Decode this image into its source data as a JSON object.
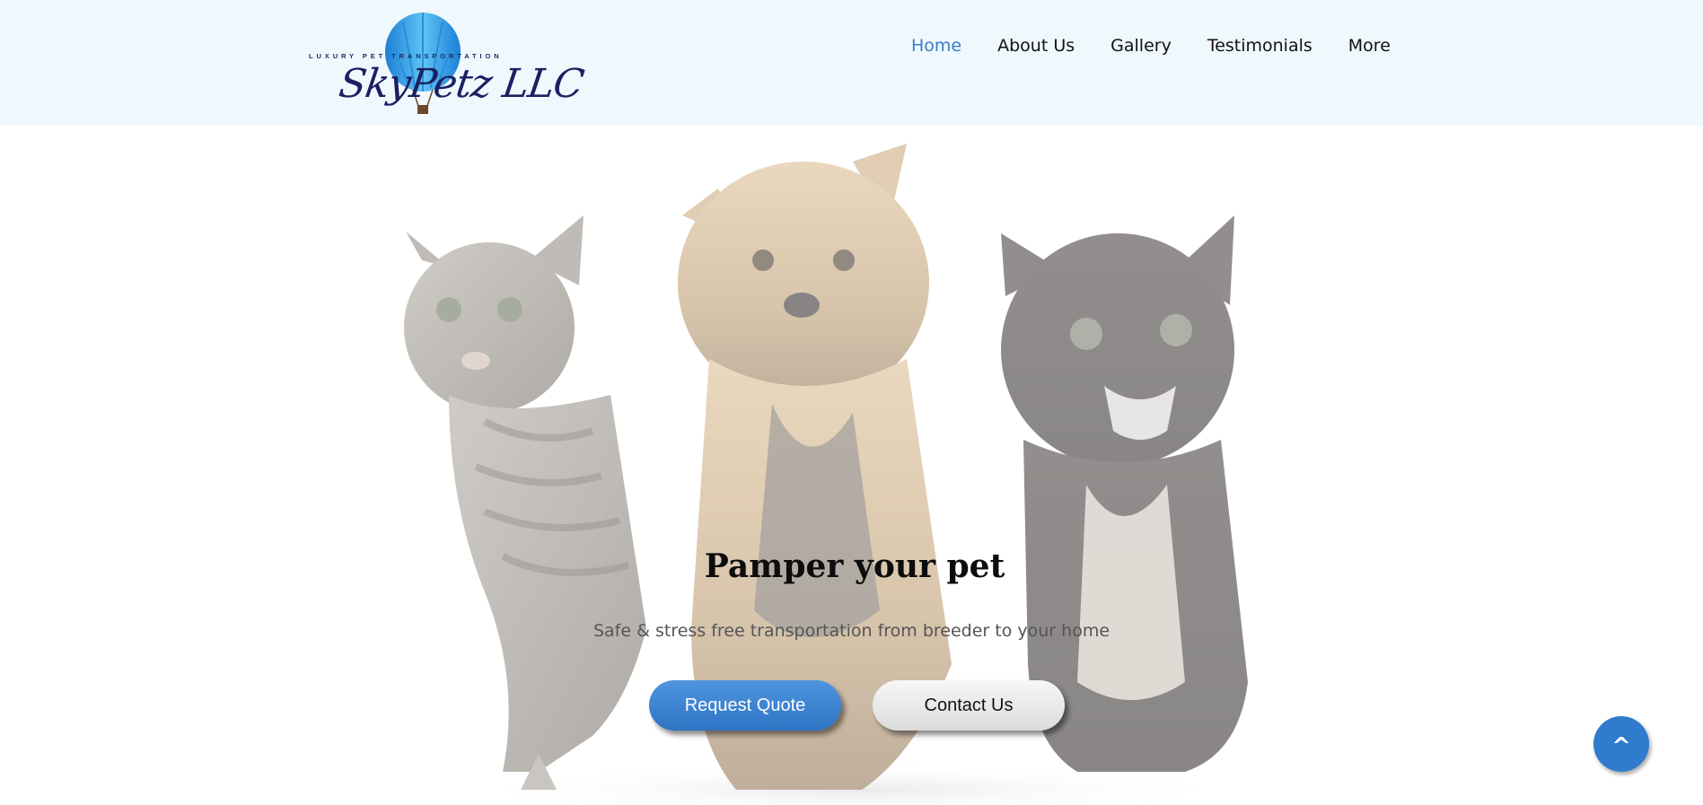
{
  "brand": {
    "tagline": "LUXURY PET TRANSPORTATION",
    "name": "SkyPetz LLC",
    "logo_icon": "hot-air-balloon",
    "balloon_color": "#3aa6e8"
  },
  "nav": {
    "items": [
      {
        "label": "Home",
        "active": true
      },
      {
        "label": "About Us",
        "active": false
      },
      {
        "label": "Gallery",
        "active": false
      },
      {
        "label": "Testimonials",
        "active": false
      },
      {
        "label": "More",
        "active": false
      }
    ]
  },
  "hero": {
    "title": "Pamper your pet",
    "subtitle": "Safe & stress free transportation from breeder to your home",
    "image": "tabby-cat-yorkshire-terrier-black-kitten",
    "buttons": {
      "request_quote": "Request Quote",
      "contact_us": "Contact Us"
    }
  },
  "scroll_top": {
    "label": "^",
    "icon": "chevron-up-icon"
  },
  "colors": {
    "header_bg": "#eff8fd",
    "accent": "#3b7fc4",
    "primary_button": "#3a82d0",
    "secondary_button": "#e6e6e6"
  }
}
